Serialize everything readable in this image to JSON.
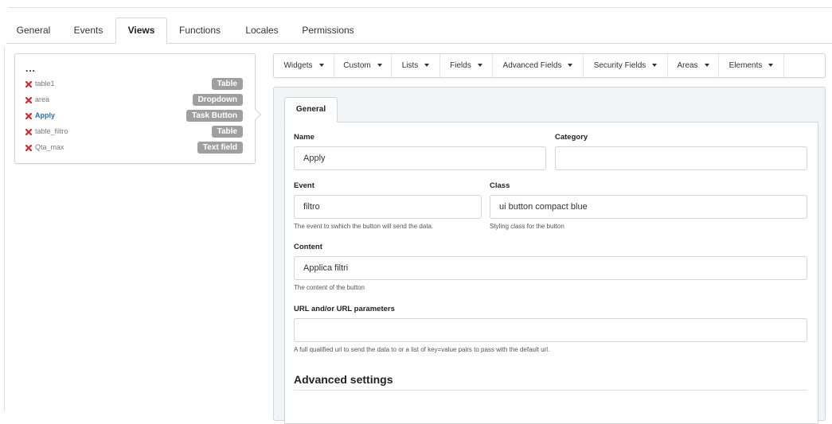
{
  "main_tabs": [
    {
      "label": "General",
      "active": false
    },
    {
      "label": "Events",
      "active": false
    },
    {
      "label": "Views",
      "active": true
    },
    {
      "label": "Functions",
      "active": false
    },
    {
      "label": "Locales",
      "active": false
    },
    {
      "label": "Permissions",
      "active": false
    }
  ],
  "views_panel": {
    "header": "...",
    "items": [
      {
        "name": "table1",
        "type": "Table",
        "active": false
      },
      {
        "name": "area",
        "type": "Dropdown",
        "active": false
      },
      {
        "name": "Apply",
        "type": "Task Button",
        "active": true
      },
      {
        "name": "table_filtro",
        "type": "Table",
        "active": false
      },
      {
        "name": "Qta_max",
        "type": "Text field",
        "active": false
      }
    ]
  },
  "toolbar": [
    {
      "label": "Widgets"
    },
    {
      "label": "Custom"
    },
    {
      "label": "Lists"
    },
    {
      "label": "Fields"
    },
    {
      "label": "Advanced Fields"
    },
    {
      "label": "Security Fields"
    },
    {
      "label": "Areas"
    },
    {
      "label": "Elements"
    }
  ],
  "editor": {
    "tab_label": "General",
    "name": {
      "label": "Name",
      "value": "Apply"
    },
    "category": {
      "label": "Category",
      "value": ""
    },
    "event": {
      "label": "Event",
      "value": "filtro",
      "help": "The event to swhich the button will send the data."
    },
    "class": {
      "label": "Class",
      "value": "ui button compact blue",
      "help": "Styling class for the button"
    },
    "content": {
      "label": "Content",
      "value": "Applica filtri",
      "help": "The content of the button"
    },
    "url": {
      "label": "URL and/or URL parameters",
      "value": "",
      "help": "A full qualified url to send the data to or a list of key=value pairs to pass with the default url."
    },
    "advanced_title": "Advanced settings"
  },
  "colors": {
    "delete_icon": "#db2828",
    "active_link": "#1e70bf",
    "badge": "#9f9f9f"
  }
}
